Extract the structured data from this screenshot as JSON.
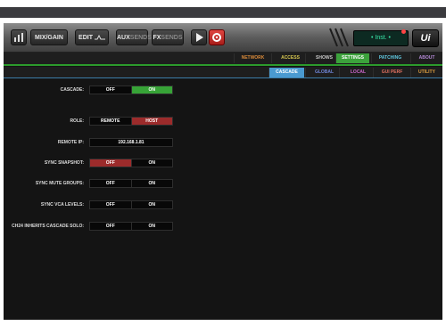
{
  "toolbar": {
    "mix_gain_label": "MIX/GAIN",
    "edit_label": "EDIT",
    "aux_label": "AUX",
    "aux_sends": "SENDS",
    "fx_label": "FX",
    "fx_sends": "SENDS",
    "lcd_text": "• Inst. •",
    "logo_text": "Ui"
  },
  "main_tabs": [
    "NETWORK",
    "ACCESS",
    "SHOWS",
    "SETTINGS",
    "PATCHING",
    "ABOUT"
  ],
  "main_tab_colors": [
    "#d98a3a",
    "#d8c850",
    "#c9c9c9",
    "#ffffff",
    "#5fc8e0",
    "#b58ad8"
  ],
  "sub_tabs": [
    "CASCADE",
    "GLOBAL",
    "LOCAL",
    "GUI PERF",
    "UTILITY"
  ],
  "sub_tab_colors": [
    "#ffffff",
    "#6f86d8",
    "#cc66cc",
    "#e07060",
    "#e0a040"
  ],
  "settings": {
    "cascade": {
      "label": "CASCADE:",
      "opt1": "OFF",
      "opt2": "ON"
    },
    "role": {
      "label": "ROLE:",
      "opt1": "REMOTE",
      "opt2": "HOST"
    },
    "remote_ip": {
      "label": "REMOTE IP:",
      "value": "192.168.1.81"
    },
    "sync_snapshot": {
      "label": "SYNC SNAPSHOT:",
      "opt1": "OFF",
      "opt2": "ON"
    },
    "sync_mute": {
      "label": "SYNC MUTE GROUPS:",
      "opt1": "OFF",
      "opt2": "ON"
    },
    "sync_vca": {
      "label": "SYNC VCA LEVELS:",
      "opt1": "OFF",
      "opt2": "ON"
    },
    "ch24": {
      "label": "CH24 INHERITS CASCADE SOLO:",
      "opt1": "OFF",
      "opt2": "ON"
    }
  }
}
